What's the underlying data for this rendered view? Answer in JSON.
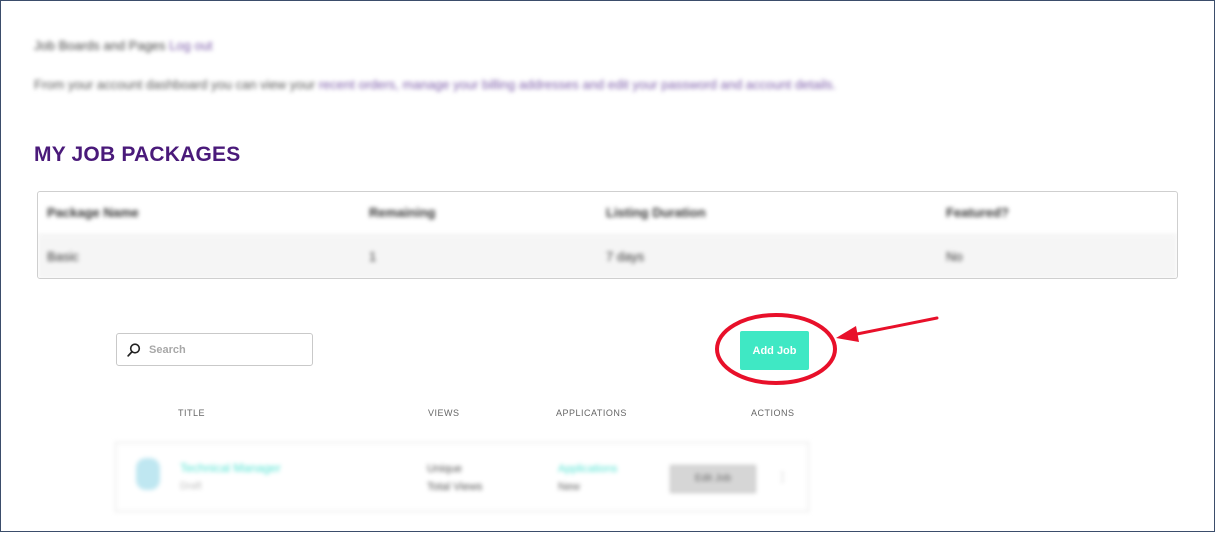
{
  "intro": {
    "line1_text": "Job Boards and Pages",
    "line1_link": "Log out",
    "line2_text": "From your account dashboard you can view your",
    "line2_link": "recent orders, manage your billing addresses and edit your password and account details."
  },
  "heading": "MY JOB PACKAGES",
  "packages_table": {
    "headers": [
      "Package Name",
      "Remaining",
      "Listing Duration",
      "Featured?"
    ],
    "rows": [
      [
        "Basic",
        "1",
        "7 days",
        "No"
      ]
    ]
  },
  "search": {
    "placeholder": "Search"
  },
  "add_job_label": "Add Job",
  "jobs_table": {
    "headers": {
      "title": "TITLE",
      "views": "VIEWS",
      "applications": "APPLICATIONS",
      "actions": "ACTIONS"
    },
    "rows": [
      {
        "title": "Technical Manager",
        "subtitle": "Draft",
        "views_line1": "Unique",
        "views_line2": "Total Views",
        "apps_line1": "Applications",
        "apps_line2": "New",
        "action_label": "Edit Job",
        "more": "⋮"
      }
    ]
  },
  "colors": {
    "heading": "#4a1a7a",
    "accent": "#3fe8c4",
    "annotation": "#e8102a",
    "frame": "#3b4d6b"
  },
  "icons": [
    "search-icon",
    "annotation-circle",
    "annotation-arrow"
  ]
}
